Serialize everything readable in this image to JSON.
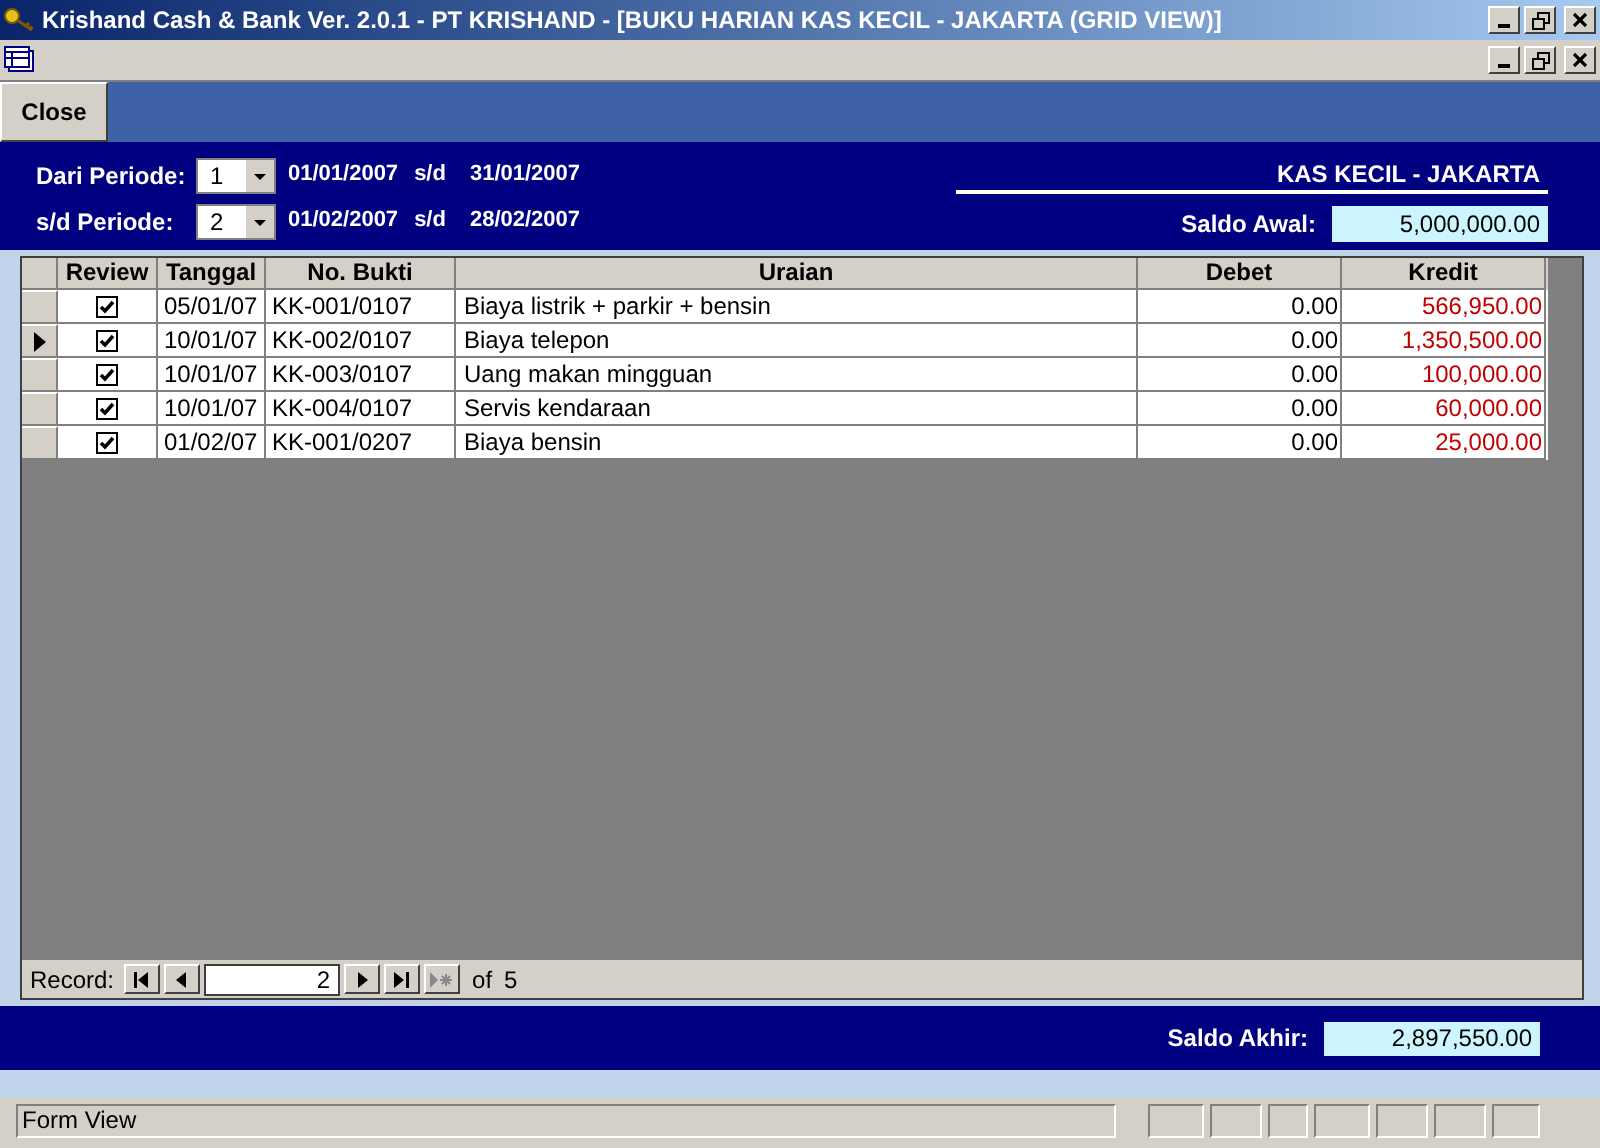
{
  "window": {
    "title": "Krishand Cash & Bank Ver. 2.0.1 - PT KRISHAND - [BUKU HARIAN KAS KECIL - JAKARTA (GRID VIEW)]"
  },
  "toolbar": {
    "close_button": {
      "label": "Close"
    }
  },
  "header": {
    "periods": [
      {
        "label": "Dari Periode:",
        "value": "1",
        "from": "01/01/2007",
        "sep": "s/d",
        "to": "31/01/2007"
      },
      {
        "label": "s/d Periode:",
        "value": "2",
        "from": "01/02/2007",
        "sep": "s/d",
        "to": "28/02/2007"
      }
    ],
    "account": "KAS KECIL - JAKARTA",
    "saldo_awal": {
      "label": "Saldo Awal:",
      "value": "5,000,000.00"
    }
  },
  "table": {
    "columns": [
      {
        "label": "Review"
      },
      {
        "label": "Tanggal"
      },
      {
        "label": "No. Bukti"
      },
      {
        "label": "Uraian"
      },
      {
        "label": "Debet"
      },
      {
        "label": "Kredit"
      }
    ],
    "rows": [
      {
        "selected": false,
        "checked": true,
        "tanggal": "05/01/07",
        "bukti": "KK-001/0107",
        "uraian": "Biaya listrik + parkir + bensin",
        "debet": "0.00",
        "kredit": "566,950.00"
      },
      {
        "selected": true,
        "checked": true,
        "tanggal": "10/01/07",
        "bukti": "KK-002/0107",
        "uraian": "Biaya telepon",
        "debet": "0.00",
        "kredit": "1,350,500.00"
      },
      {
        "selected": false,
        "checked": true,
        "tanggal": "10/01/07",
        "bukti": "KK-003/0107",
        "uraian": "Uang makan mingguan",
        "debet": "0.00",
        "kredit": "100,000.00"
      },
      {
        "selected": false,
        "checked": true,
        "tanggal": "10/01/07",
        "bukti": "KK-004/0107",
        "uraian": "Servis kendaraan",
        "debet": "0.00",
        "kredit": "60,000.00"
      },
      {
        "selected": false,
        "checked": true,
        "tanggal": "01/02/07",
        "bukti": "KK-001/0207",
        "uraian": "Biaya bensin",
        "debet": "0.00",
        "kredit": "25,000.00"
      }
    ]
  },
  "record_nav": {
    "label": "Record:",
    "current": "2",
    "of": "of",
    "total": "5"
  },
  "saldo_akhir": {
    "label": "Saldo Akhir:",
    "value": "2,897,550.00"
  },
  "status_bar": {
    "text": "Form View"
  }
}
